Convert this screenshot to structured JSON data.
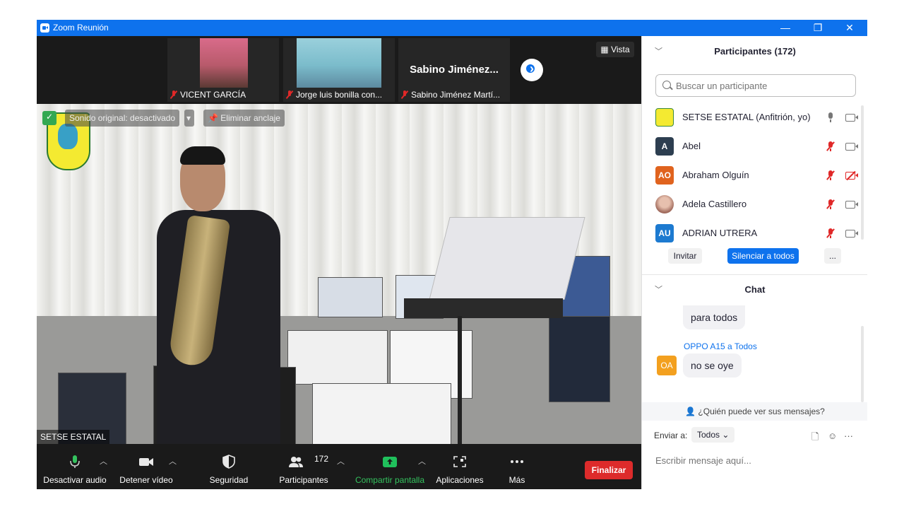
{
  "window": {
    "title": "Zoom Reunión",
    "controls": {
      "minimize": "—",
      "restore": "❐",
      "close": "✕"
    }
  },
  "thumbnails": [
    {
      "name": "VICENT GARCÍA",
      "muted": true
    },
    {
      "name": "Jorge luis bonilla con...",
      "muted": true
    },
    {
      "display_name": "Sabino  Jiménez...",
      "name": "Sabino Jiménez Martí...",
      "muted": true
    }
  ],
  "view_button": "Vista",
  "stage": {
    "original_sound": "Sonido original: desactivado",
    "unpin": "Eliminar anclaje",
    "speaker": "SETSE ESTATAL"
  },
  "toolbar": {
    "audio": "Desactivar audio",
    "video": "Detener vídeo",
    "security": "Seguridad",
    "participants": "Participantes",
    "participants_count": "172",
    "share": "Compartir pantalla",
    "apps": "Aplicaciones",
    "more": "Más",
    "end": "Finalizar"
  },
  "participants_panel": {
    "title": "Participantes (172)",
    "search_placeholder": "Buscar un participante",
    "people": [
      {
        "initials": "",
        "name": "SETSE ESTATAL (Anfitrión, yo)",
        "color": "#f4ea31",
        "mic_muted": false,
        "cam_off": false
      },
      {
        "initials": "A",
        "name": "Abel",
        "color": "#2d3e50",
        "mic_muted": true,
        "cam_off": false
      },
      {
        "initials": "AO",
        "name": "Abraham Olguín",
        "color": "#e0631e",
        "mic_muted": true,
        "cam_off": true
      },
      {
        "initials": "",
        "name": "Adela Castillero",
        "color": "#d8a89a",
        "mic_muted": true,
        "cam_off": false
      },
      {
        "initials": "AU",
        "name": "ADRIAN UTRERA",
        "color": "#1d7ad0",
        "mic_muted": true,
        "cam_off": false
      }
    ],
    "invite": "Invitar",
    "mute_all": "Silenciar a todos",
    "more": "..."
  },
  "chat_panel": {
    "title": "Chat",
    "messages": [
      {
        "text": "para todos"
      },
      {
        "sender": "OPPO A15 a Todos",
        "initials": "OA",
        "text": "no se oye"
      }
    ],
    "who_can_see": "¿Quién puede ver sus mensajes?",
    "send_to_label": "Enviar a:",
    "send_to_value": "Todos",
    "input_placeholder": "Escribir mensaje aquí..."
  },
  "colors": {
    "accent": "#0e72ed",
    "end_button": "#dd2b2b",
    "share_green": "#20c05c",
    "muted_red": "#e02828"
  }
}
